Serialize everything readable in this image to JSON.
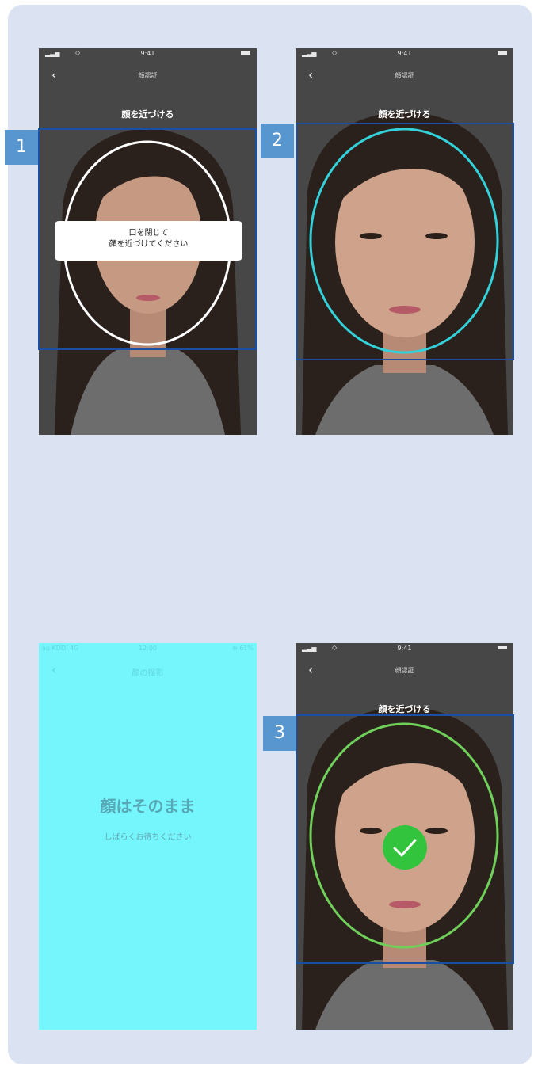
{
  "figure": {
    "steps": [
      {
        "number": "1"
      },
      {
        "number": "2"
      },
      {
        "number": "3"
      }
    ]
  },
  "camera_screen": {
    "status_time": "9:41",
    "nav_title": "顔認証",
    "heading": "顔を近づける",
    "back_icon": "chevron-left-icon",
    "tooltip_line1": "口を閉じて",
    "tooltip_line2": "顔を近づけてください"
  },
  "processing_screen": {
    "status_carrier": "au KDDI 4G",
    "status_time": "12:00",
    "status_right": "⊕ 61%",
    "nav_title": "顔の撮影",
    "message_title": "顔はそのまま",
    "message_sub": "しばらくお待ちください"
  },
  "colors": {
    "guide_default": "#ffffff",
    "guide_detected": "#33d1da",
    "guide_success": "#6fd05a",
    "check_badge": "#31c43c",
    "highlight_box": "#1b4fa3",
    "step_badge": "#5796cf",
    "processing_background": "#74f6fc"
  }
}
